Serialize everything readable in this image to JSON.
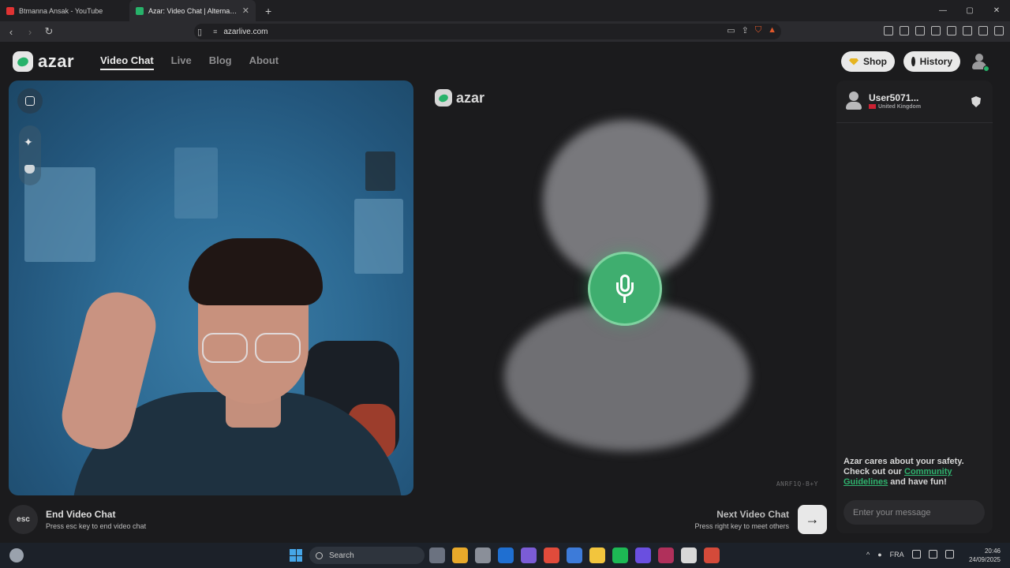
{
  "browser": {
    "tabs": [
      {
        "title": "Btmanna Ansak - YouTube",
        "favicon_color": "#e03333"
      },
      {
        "title": "Azar: Video Chat | Alternative",
        "favicon_color": "#27b26a"
      }
    ],
    "new_tab": "+",
    "url": "azarlive.com",
    "window_controls": [
      "—",
      "▢",
      "✕"
    ]
  },
  "site": {
    "logo_text": "azar",
    "nav": [
      {
        "label": "Video Chat",
        "active": true
      },
      {
        "label": "Live"
      },
      {
        "label": "Blog"
      },
      {
        "label": "About"
      }
    ],
    "shop_label": "Shop",
    "history_label": "History"
  },
  "remote": {
    "logo_text": "azar",
    "code": "ANRF1Q-B+Y",
    "mic_icon": "microphone-icon"
  },
  "chat": {
    "username": "User5071...",
    "country": "United Kingdom",
    "safety_prefix": "Azar cares about your safety. Check out our ",
    "safety_link": "Community Guidelines",
    "safety_suffix": " and have fun!",
    "message_placeholder": "Enter your message"
  },
  "controls": {
    "esc_label": "esc",
    "end_title": "End Video Chat",
    "end_sub": "Press esc key to end video chat",
    "next_title": "Next Video Chat",
    "next_sub": "Press right key to meet others",
    "next_arrow": "→"
  },
  "taskbar": {
    "search_label": "Search",
    "lang": "FRA",
    "time": "20:46",
    "date": "24/09/2025",
    "app_colors": [
      "#6b7280",
      "#e8a92a",
      "#8a8f99",
      "#1f6fd1",
      "#7b5cd6",
      "#e14b3b",
      "#3d7bd9",
      "#f2c53d",
      "#1db954",
      "#6a4fe0",
      "#b0305b",
      "#d8d8d8",
      "#d44a3a"
    ]
  },
  "colors": {
    "accent_green": "#27b26a",
    "mic_green": "#3fae6f",
    "page_bg": "#1b1b1d"
  }
}
